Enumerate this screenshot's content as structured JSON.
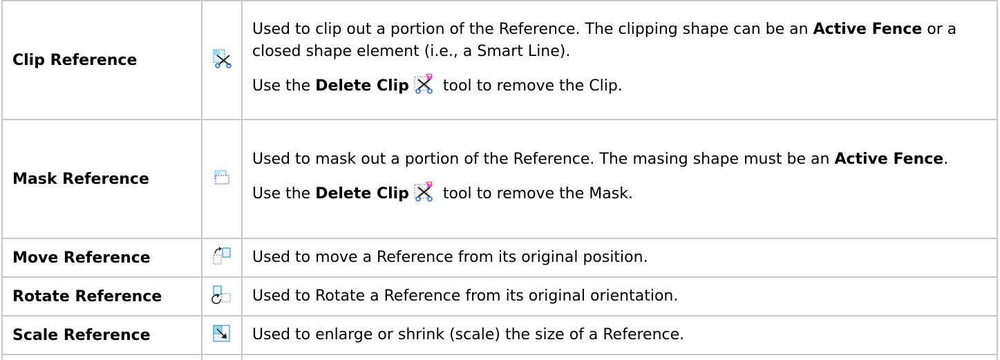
{
  "rows": [
    {
      "name": "Clip Reference",
      "icon": "clip-reference-icon",
      "line1": "Used to clip out a portion of the Reference.  The clipping shape can be an ",
      "bold1": "Active Fence",
      "line1_end": " or a closed shape element (i.e., a Smart Line).",
      "use_prefix": "Use the ",
      "use_bold": "Delete Clip",
      "use_suffix": " tool to remove the Clip."
    },
    {
      "name": "Mask Reference",
      "icon": "mask-reference-icon",
      "line1": "Used to mask out a portion of the Reference.  The masing shape must be an ",
      "bold1": "Active Fence",
      "line1_end": ".",
      "use_prefix": "Use the ",
      "use_bold": "Delete Clip",
      "use_suffix": " tool to remove the Mask."
    },
    {
      "name": "Move Reference",
      "icon": "move-reference-icon",
      "desc": "Used to move a Reference from its original position."
    },
    {
      "name": "Rotate Reference",
      "icon": "rotate-reference-icon",
      "desc": "Used to Rotate a Reference from its original orientation."
    },
    {
      "name": "Scale Reference",
      "icon": "scale-reference-icon",
      "desc": "Used to enlarge or shrink (scale) the size of a Reference."
    }
  ]
}
